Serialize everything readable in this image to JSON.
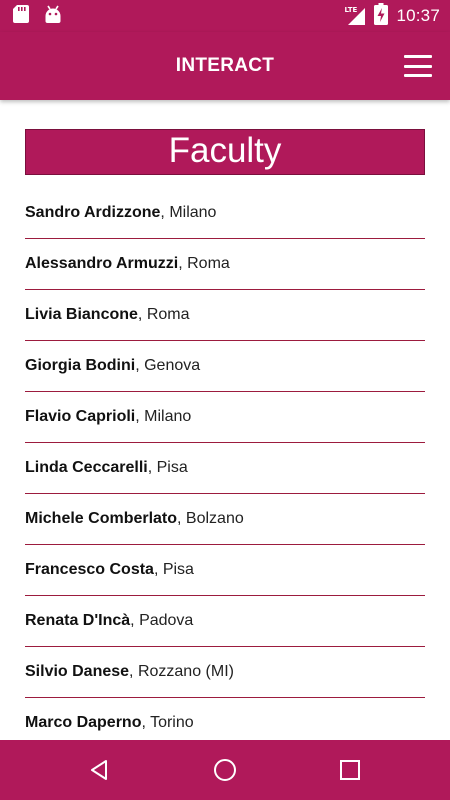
{
  "status_bar": {
    "time": "10:37",
    "network": "LTE",
    "left_icons": [
      "sd-card-icon",
      "android-icon"
    ],
    "right_icons": [
      "signal-icon",
      "battery-charging-icon"
    ]
  },
  "app_bar": {
    "title": "INTERACT",
    "menu_icon": "hamburger-menu-icon"
  },
  "section": {
    "title": "Faculty"
  },
  "faculty": [
    {
      "name": "Sandro Ardizzone",
      "city": ", Milano"
    },
    {
      "name": "Alessandro Armuzzi",
      "city": ", Roma"
    },
    {
      "name": "Livia Biancone",
      "city": ", Roma"
    },
    {
      "name": "Giorgia Bodini",
      "city": ", Genova"
    },
    {
      "name": "Flavio Caprioli",
      "city": ", Milano"
    },
    {
      "name": "Linda Ceccarelli",
      "city": ", Pisa"
    },
    {
      "name": "Michele Comberlato",
      "city": ", Bolzano"
    },
    {
      "name": "Francesco Costa",
      "city": ", Pisa"
    },
    {
      "name": "Renata D'Incà",
      "city": ", Padova"
    },
    {
      "name": "Silvio Danese",
      "city": ", Rozzano (MI)"
    },
    {
      "name": "Marco Daperno",
      "city": ", Torino"
    }
  ],
  "nav_bar": {
    "icons": [
      "back-icon",
      "home-icon",
      "recents-icon"
    ]
  },
  "colors": {
    "primary": "#b0195a",
    "divider": "#9c1b3e",
    "text": "#111111"
  }
}
